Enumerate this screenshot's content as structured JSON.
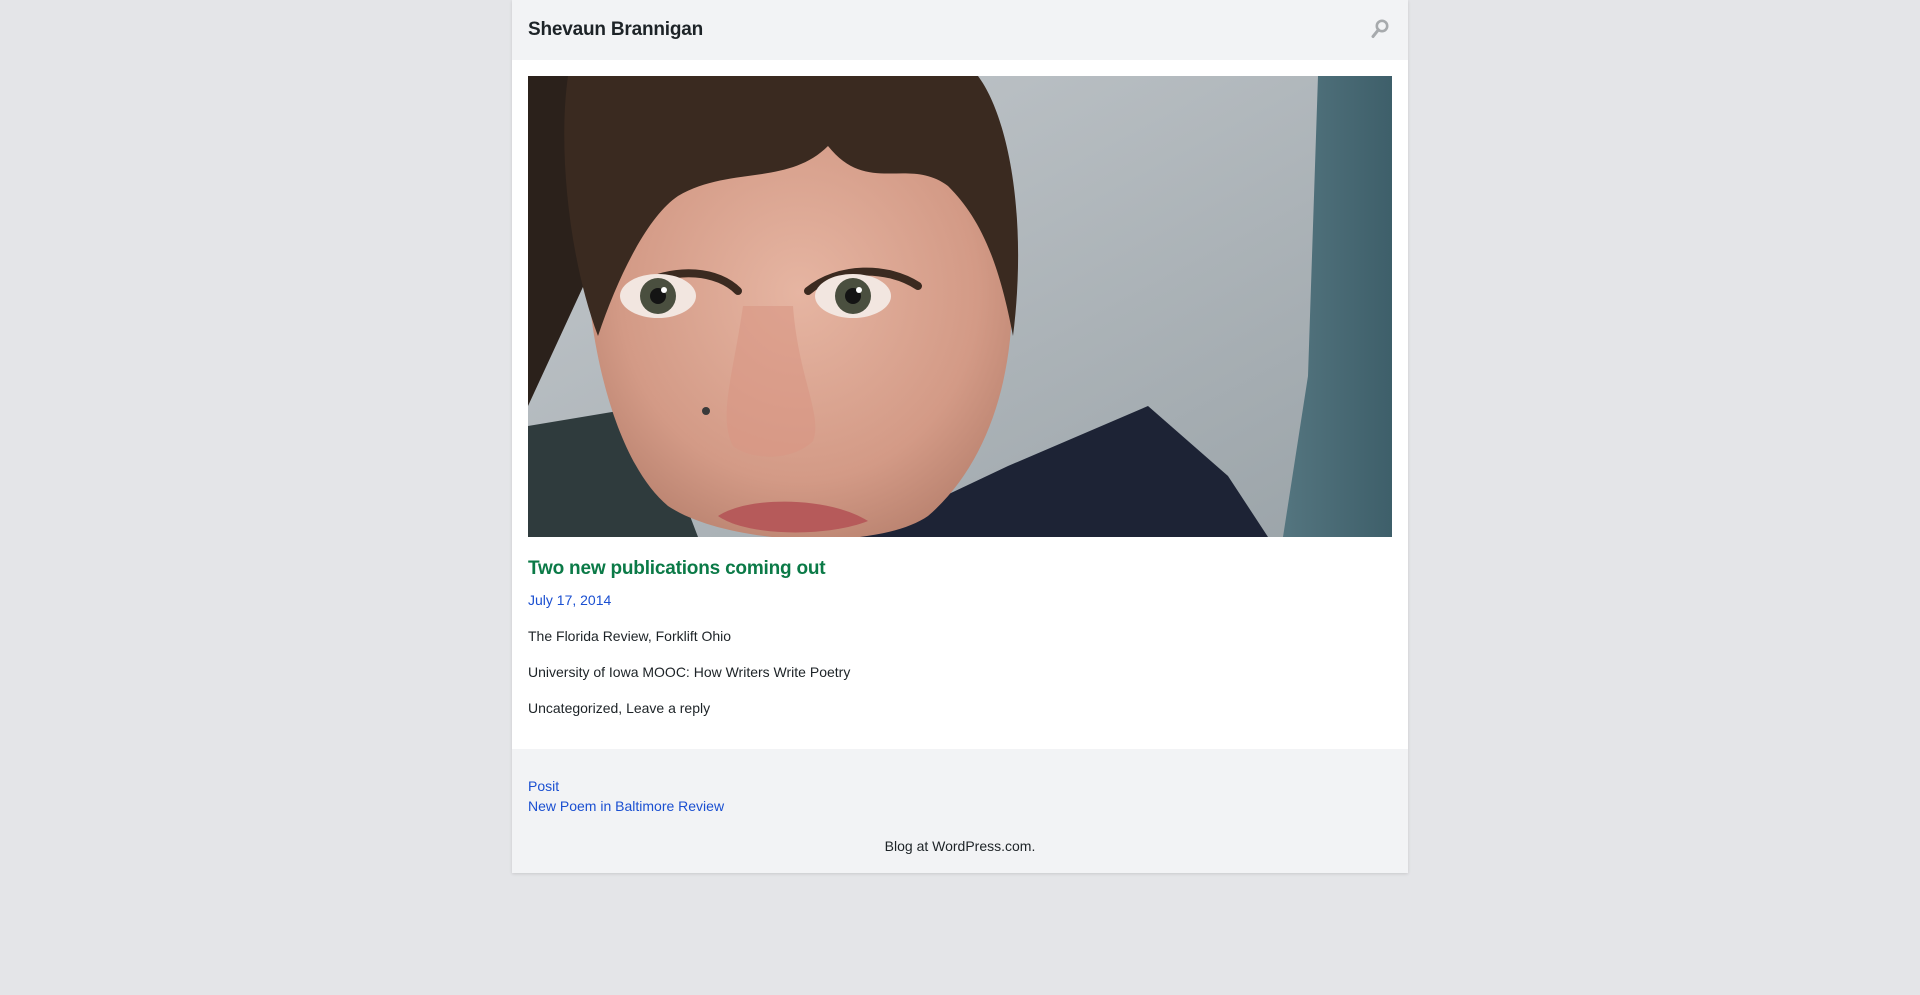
{
  "header": {
    "site_title": "Shevaun Brannigan",
    "search_icon": "search-icon"
  },
  "post": {
    "title": "Two new publications coming out",
    "date": "July 17, 2014",
    "paragraphs": [
      "The Florida Review, Forklift Ohio",
      "University of Iowa MOOC: How Writers Write Poetry"
    ],
    "category": "Uncategorized",
    "separator": ", ",
    "reply_link": "Leave a reply"
  },
  "navigation": {
    "previous": "Posit",
    "next": "New Poem in Baltimore Review"
  },
  "footer": {
    "credit": "Blog at WordPress.com."
  },
  "colors": {
    "background": "#e4e5e8",
    "title_accent": "#0b7a47",
    "link": "#1a4fd1"
  }
}
